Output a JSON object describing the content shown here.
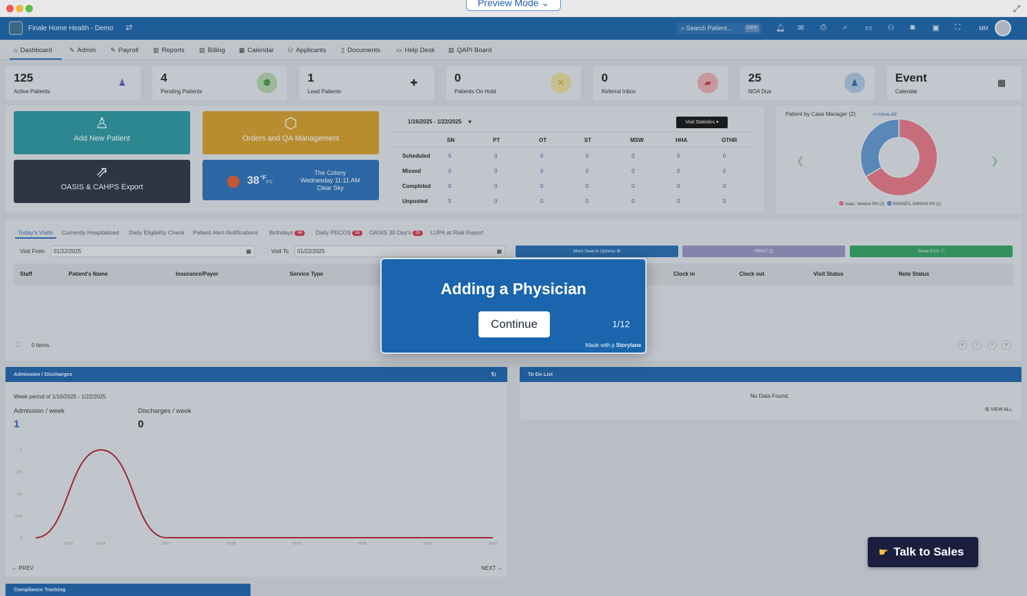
{
  "preview_label": "Preview Mode",
  "org_name": "Finale Home Health - Demo",
  "search": {
    "placeholder": "Search Patient...",
    "shortcut": "Ctrl K"
  },
  "user_initials": "MM",
  "nav": [
    "Dashboard",
    "Admin",
    "Payroll",
    "Reports",
    "Billing",
    "Calendar",
    "Applicants",
    "Documents",
    "Help Desk",
    "QAPI Board"
  ],
  "stats": [
    {
      "value": "125",
      "label": "Active Patients"
    },
    {
      "value": "4",
      "label": "Pending Patients"
    },
    {
      "value": "1",
      "label": "Lead Patients"
    },
    {
      "value": "0",
      "label": "Patients On Hold"
    },
    {
      "value": "0",
      "label": "Referral Inbox"
    },
    {
      "value": "25",
      "label": "NOA Due"
    },
    {
      "value": "Event",
      "label": "Calendar"
    }
  ],
  "quick": {
    "add_patient": "Add New Patient",
    "orders": "Orders and QA Management",
    "oasis": "OASIS & CAHPS Export",
    "weather": {
      "temp": "38",
      "unit": "°F",
      "unit_c": "3°C",
      "city": "The Colony",
      "time": "Wednesday 11:11 AM",
      "cond": "Clear Sky"
    }
  },
  "visit_stats": {
    "range": "1/16/2025 - 1/22/2025",
    "button": "Visit Statistics ▾",
    "columns": [
      "SN",
      "PT",
      "OT",
      "ST",
      "MSW",
      "HHA",
      "OTHR"
    ],
    "rows": [
      {
        "label": "Scheduled",
        "values": [
          "5",
          "0",
          "0",
          "0",
          "0",
          "0",
          "0"
        ]
      },
      {
        "label": "Missed",
        "values": [
          "0",
          "0",
          "0",
          "0",
          "0",
          "0",
          "0"
        ]
      },
      {
        "label": "Completed",
        "values": [
          "0",
          "0",
          "0",
          "0",
          "0",
          "0",
          "0"
        ]
      },
      {
        "label": "Unposted",
        "values": [
          "5",
          "0",
          "0",
          "0",
          "0",
          "0",
          "0"
        ]
      }
    ]
  },
  "case_manager": {
    "title": "Patient by Case Manager",
    "count": "(2)",
    "view_all": "View All",
    "legend": [
      "Isaac, Newton RN (2)",
      "RAMSES, AMISHA RN (1)"
    ],
    "colors": [
      "#d9707f",
      "#5b8fc4"
    ]
  },
  "tabs": [
    {
      "label": "Today's Visits",
      "badge": ""
    },
    {
      "label": "Currently Hospitalized",
      "badge": ""
    },
    {
      "label": "Daily Eligibility Check",
      "badge": ""
    },
    {
      "label": "Patient Alert-Notifications",
      "badge": ""
    },
    {
      "label": "Birthdays",
      "badge": "64"
    },
    {
      "label": "Daily PECOS",
      "badge": "16"
    },
    {
      "label": "OASIS 30 Day's",
      "badge": "25"
    },
    {
      "label": "LUPA at Risk Report",
      "badge": ""
    }
  ],
  "filters": {
    "visit_from_label": "Visit From",
    "visit_from": "01/22/2025",
    "visit_to_label": "Visit To",
    "visit_to": "01/22/2025",
    "more_search": "More Search Options ⚙",
    "print": "PRINT ⎙",
    "show_evv": "Show EVV ⓘ"
  },
  "table_headers": [
    "Staff",
    "Patient's Name",
    "Insurance/Payer",
    "Service Type",
    "Clock in",
    "Clock out",
    "Visit Status",
    "Note Status"
  ],
  "items_count": "0 items",
  "admission": {
    "title": "Admission / Discharges",
    "period": "Week period of 1/16/2025 - 1/22/2025",
    "admission_label": "Admission / week",
    "admission_value": "1",
    "discharges_label": "Discharges / week",
    "discharges_value": "0",
    "prev": "← PREV",
    "next": "NEXT →"
  },
  "todo": {
    "title": "To Do List",
    "empty": "No Data Found.",
    "view_all": "VIEW ALL"
  },
  "compliance_title": "Compliance Tracking",
  "modal": {
    "title": "Adding a Physician",
    "button": "Continue",
    "step": "1/12",
    "made_with": "Made with",
    "brand": "Storylane"
  },
  "sales_button": "Talk to Sales",
  "chart_data": {
    "type": "line",
    "x": [
      "01/15",
      "01/16",
      "01/17",
      "01/18",
      "01/19",
      "01/20",
      "01/21",
      "01/22"
    ],
    "series": [
      {
        "values": [
          0,
          1,
          0,
          0,
          0,
          0,
          0,
          0
        ]
      }
    ],
    "y_ticks": [
      "0",
      "0.25",
      "0.5",
      "0.75",
      "1"
    ],
    "ylim": [
      0,
      1
    ],
    "color": "#a81f2a"
  }
}
